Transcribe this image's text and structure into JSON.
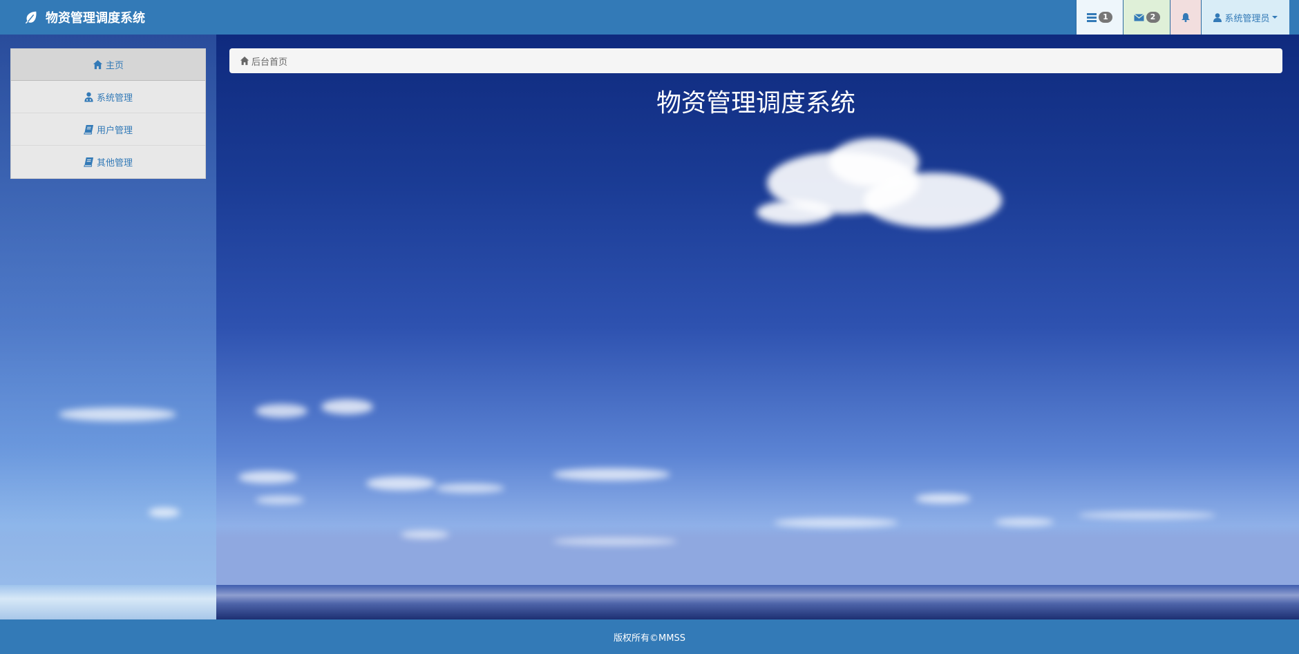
{
  "header": {
    "brand": "物资管理调度系统",
    "tasks_badge": "1",
    "mail_badge": "2",
    "user_label": "系统管理员"
  },
  "sidebar": {
    "items": [
      {
        "label": "主页",
        "icon": "home-icon"
      },
      {
        "label": "系统管理",
        "icon": "user-admin-icon"
      },
      {
        "label": "用户管理",
        "icon": "book-icon"
      },
      {
        "label": "其他管理",
        "icon": "book-icon"
      }
    ]
  },
  "breadcrumb": {
    "home": "后台首页"
  },
  "main": {
    "title": "物资管理调度系统"
  },
  "footer": {
    "copyright": "版权所有©MMSS"
  },
  "colors": {
    "primary": "#337ab7",
    "sky_dark": "#0f2a7e",
    "sky_light": "#8fb0e8"
  }
}
